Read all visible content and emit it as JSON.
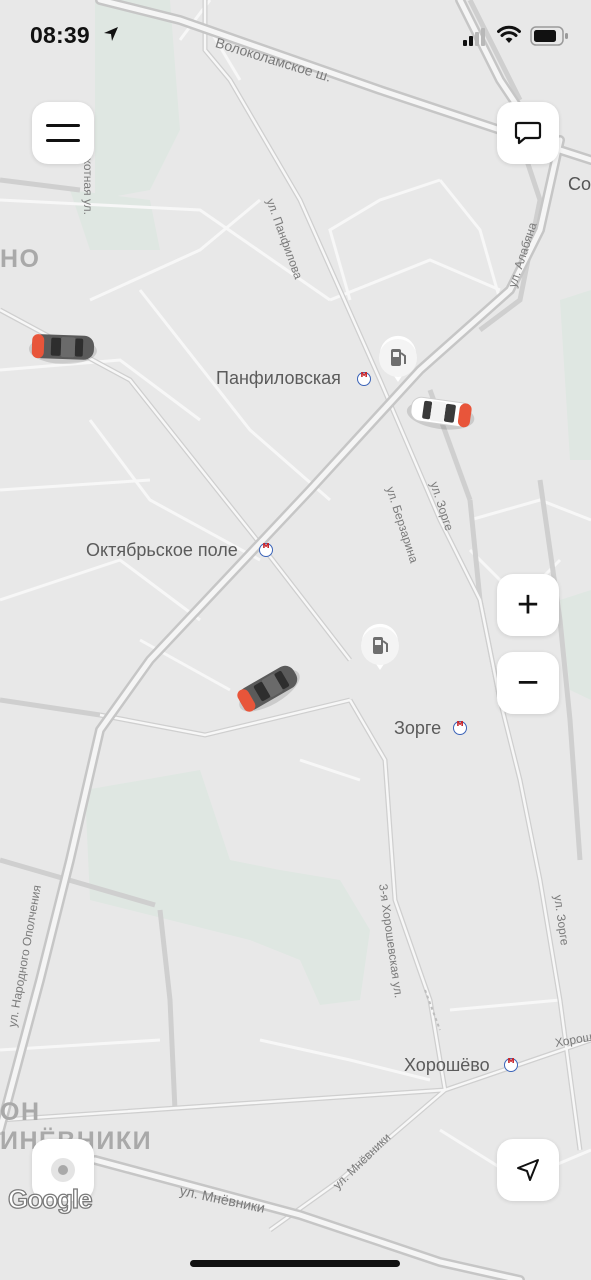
{
  "status_bar": {
    "time": "08:39"
  },
  "map": {
    "stations": [
      {
        "name": "Панфиловская"
      },
      {
        "name": "Октябрьское поле"
      },
      {
        "name": "Зорге"
      },
      {
        "name": "Хорошёво"
      }
    ],
    "streets": {
      "volokolamskoe": "Волоколамское ш.",
      "pekhotnaya": "Пехотная ул.",
      "panfilova": "ул. Панфилова",
      "alabyana": "ул. Алабяна",
      "berzarina": "ул. Берзарина",
      "zorge1": "ул. Зорге",
      "zorge2": "ул. Зорге",
      "khoroshevskaya": "3-я Хорошевская ул.",
      "narodnogo": "ул. Народного Ополчения",
      "mnyovniki": "ул. Мнёвники",
      "mnyovniki2": "ул. Мнёвники",
      "khorosh_edge": "Хорош",
      "so_edge": "Со"
    },
    "districts": {
      "top_left": "НО",
      "bottom_left_1": "ОН",
      "bottom_left_2": "ИНЁВНИКИ"
    },
    "attribution": "Google"
  },
  "buttons": {
    "menu_icon": "menu-icon",
    "chat_icon": "chat-icon",
    "zoom_in": "+",
    "zoom_out": "−",
    "navigate_icon": "navigation-arrow-icon",
    "location_icon": "target-icon"
  },
  "colors": {
    "accent": "#e8553a",
    "map_bg": "#e8e8e8",
    "park": "#dde6e0"
  }
}
